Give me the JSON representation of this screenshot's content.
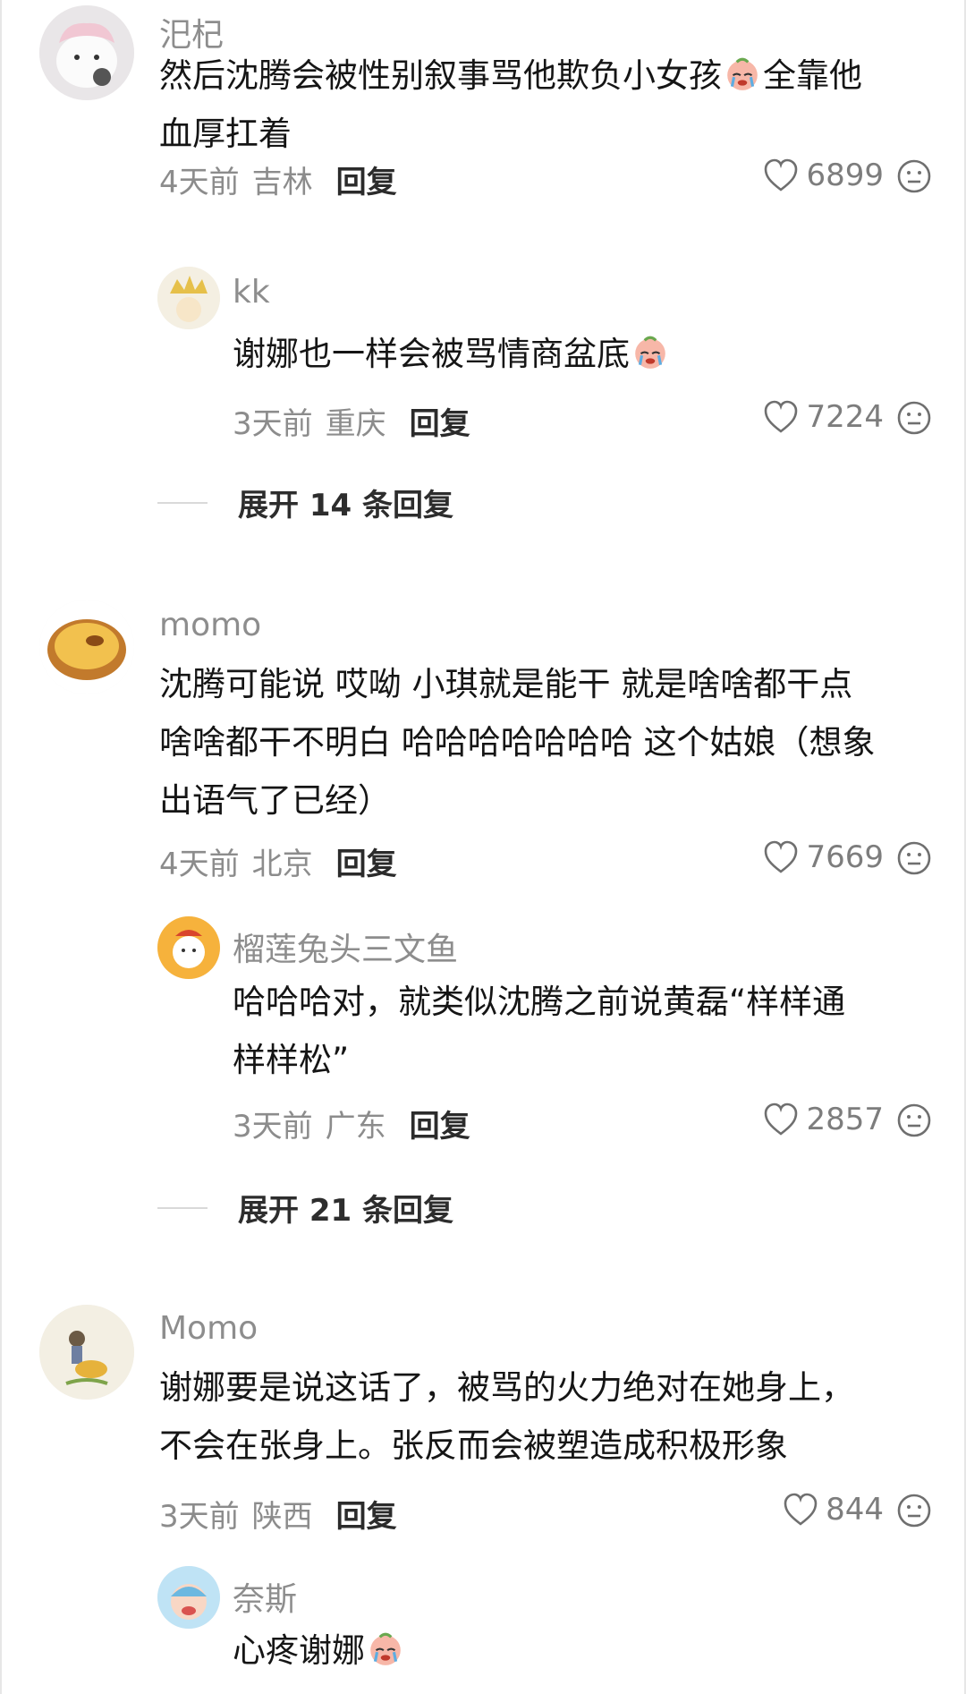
{
  "comments": [
    {
      "user": "汜杞",
      "lines": [
        "然后沈腾会被性别叙事骂他欺负小女孩😭全靠他",
        "血厚扛着"
      ],
      "time": "4天前",
      "location": "吉林",
      "reply_label": "回复",
      "likes": "6899",
      "reply": {
        "user": "kk",
        "lines": [
          "谢娜也一样会被骂情商盆底😭"
        ],
        "time": "3天前",
        "location": "重庆",
        "reply_label": "回复",
        "likes": "7224"
      },
      "expand": "展开 14 条回复"
    },
    {
      "user": "momo",
      "lines": [
        "沈腾可能说 哎呦 小琪就是能干 就是啥啥都干点",
        "啥啥都干不明白 哈哈哈哈哈哈哈 这个姑娘（想象",
        "出语气了已经）"
      ],
      "time": "4天前",
      "location": "北京",
      "reply_label": "回复",
      "likes": "7669",
      "reply": {
        "user": "榴莲兔头三文鱼",
        "lines": [
          "哈哈哈对，就类似沈腾之前说黄磊“样样通",
          "样样松”"
        ],
        "time": "3天前",
        "location": "广东",
        "reply_label": "回复",
        "likes": "2857"
      },
      "expand": "展开 21 条回复"
    },
    {
      "user": "Momo",
      "lines": [
        "谢娜要是说这话了，被骂的火力绝对在她身上，",
        "不会在张身上。张反而会被塑造成积极形象"
      ],
      "time": "3天前",
      "location": "陕西",
      "reply_label": "回复",
      "likes": "844",
      "reply": {
        "user": "奈斯",
        "lines": [
          "心疼谢娜😭"
        ]
      }
    }
  ],
  "icons": {
    "like": "heart-outline-icon",
    "dislike": "meh-face-icon",
    "emoji": "crying-face-emoji"
  },
  "colors": {
    "username": "#8d8d8d",
    "text": "#151515",
    "meta": "#8c8c8c"
  }
}
